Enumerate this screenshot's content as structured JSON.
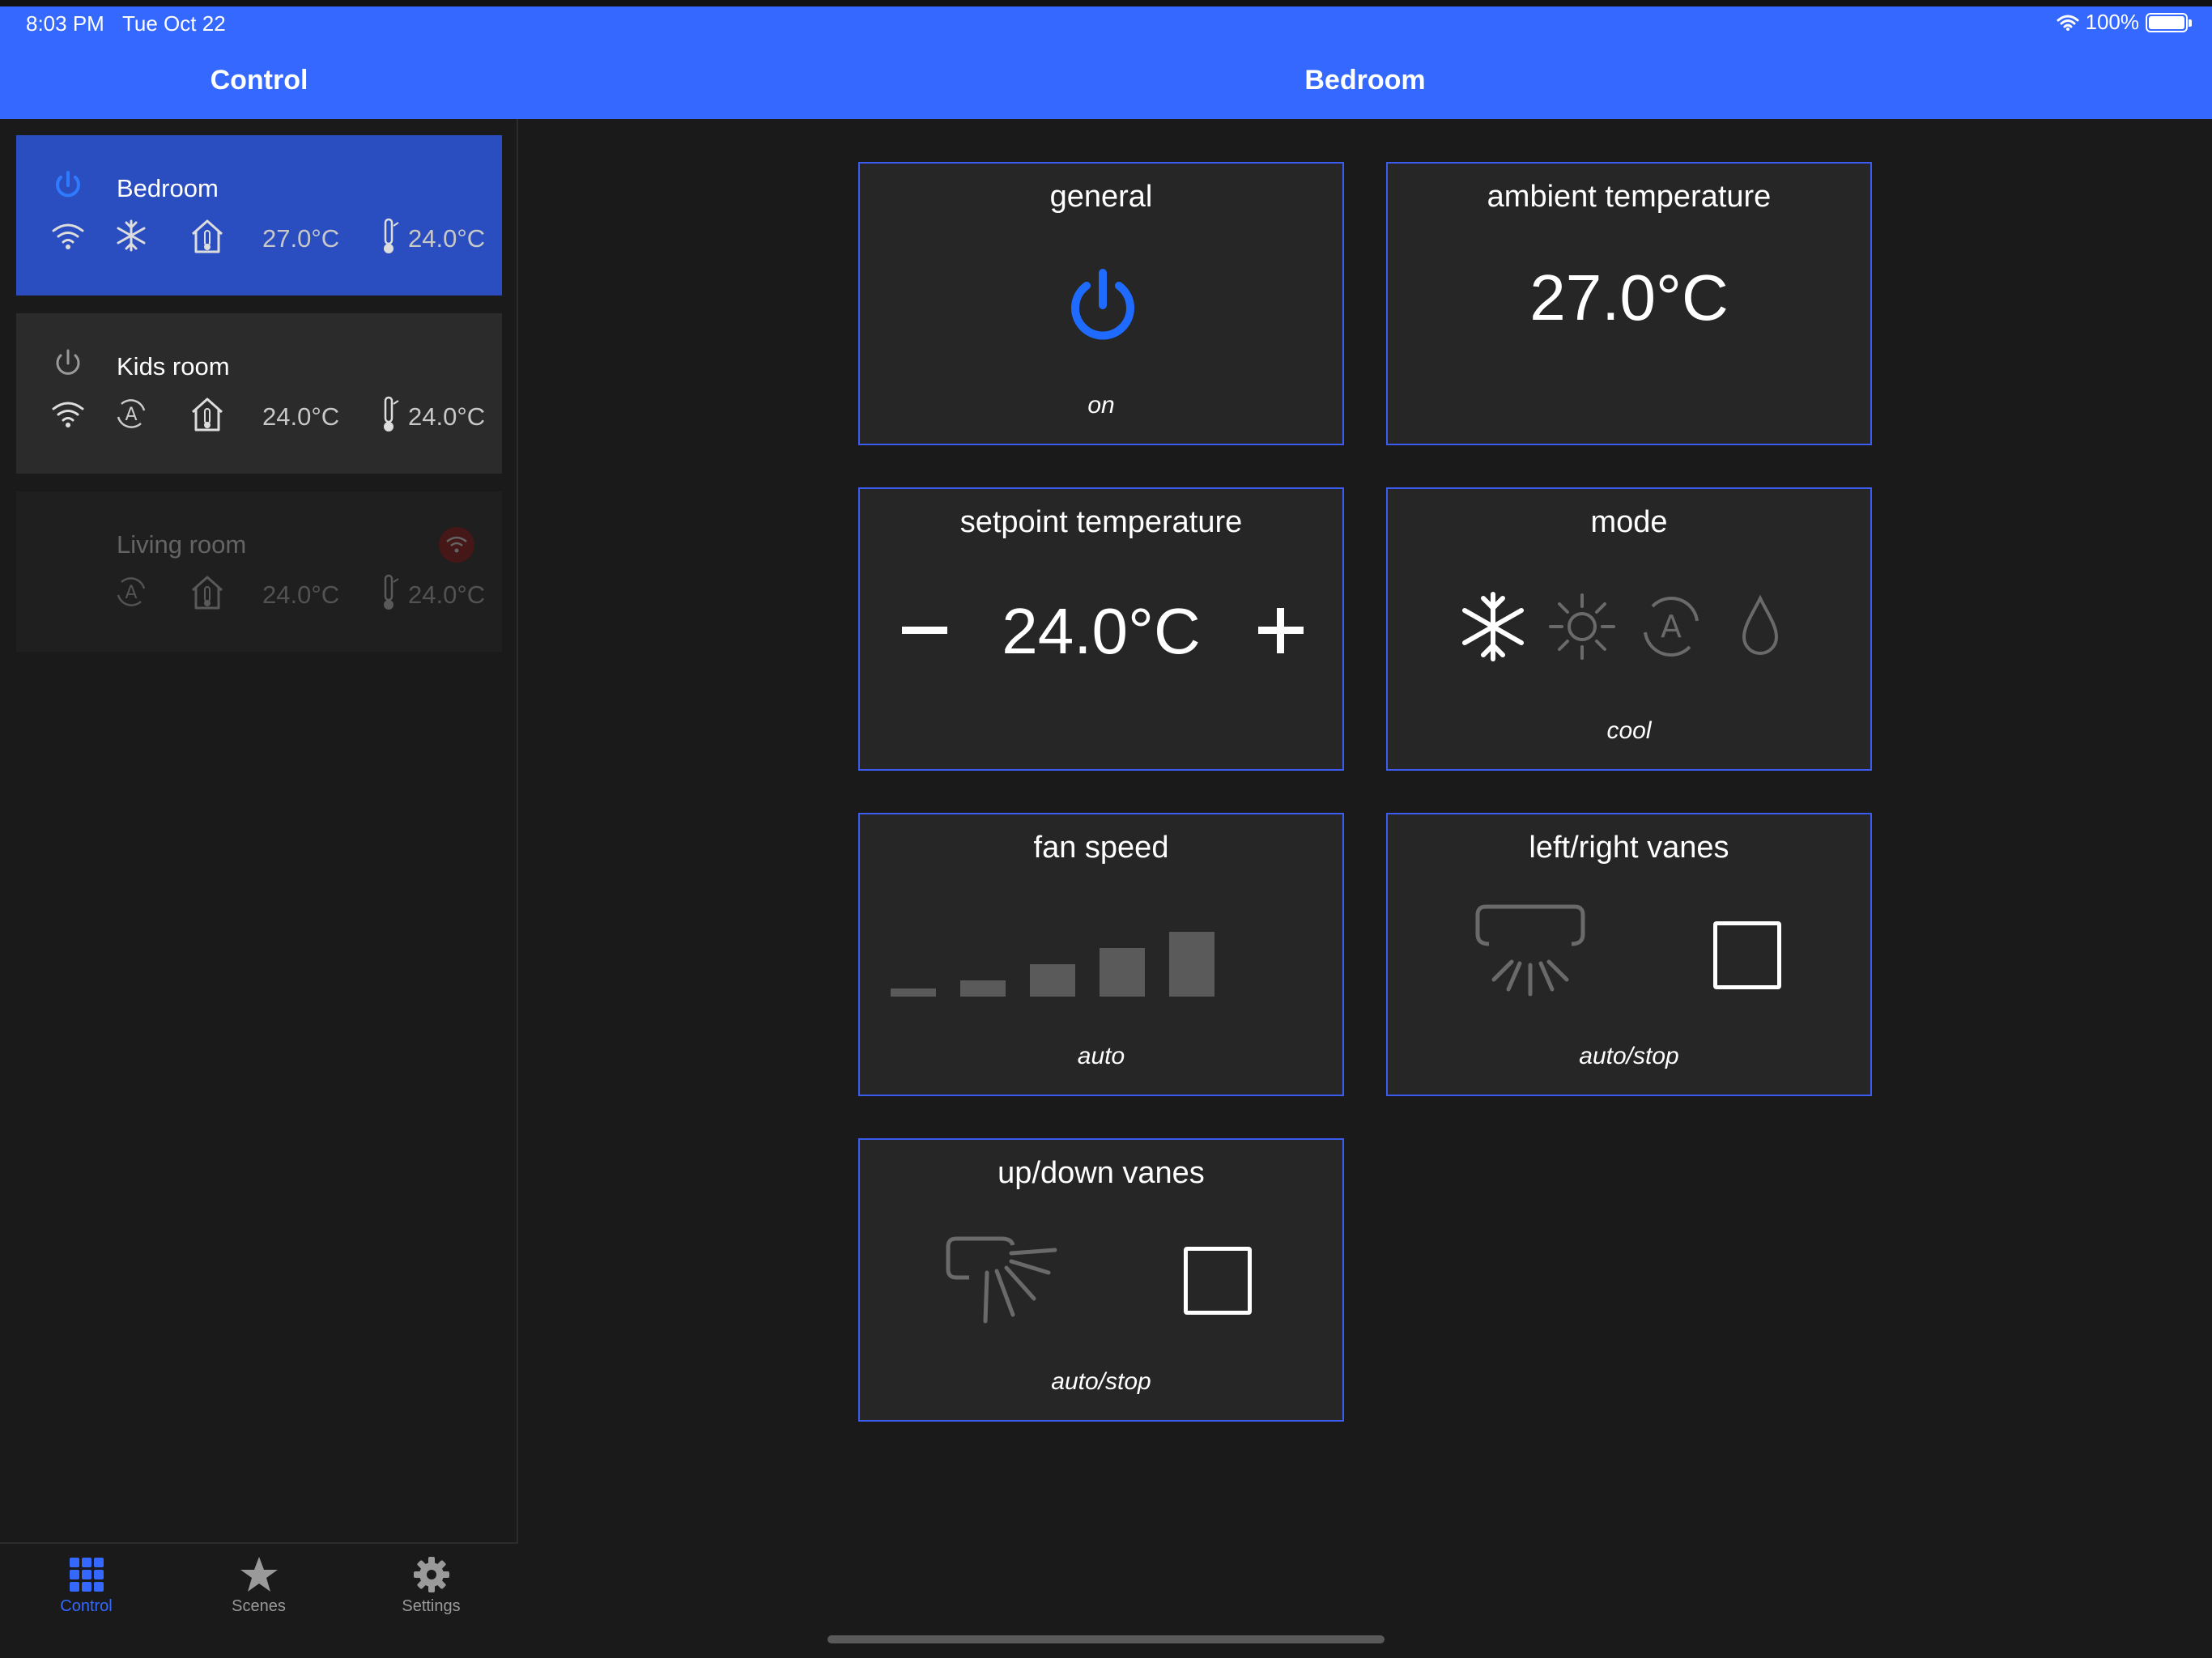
{
  "status": {
    "time": "8:03 PM",
    "date": "Tue Oct 22",
    "battery": "100%"
  },
  "header": {
    "left_title": "Control",
    "main_title": "Bedroom"
  },
  "colors": {
    "accent": "#3468fe",
    "tile_border": "#3a5cf0",
    "active_card": "#2a4ebf",
    "error": "#a01212"
  },
  "sidebar": {
    "rooms": [
      {
        "name": "Bedroom",
        "state": "on",
        "mode_icon": "snowflake-icon",
        "ambient": "27.0°C",
        "setpoint": "24.0°C",
        "connected": true
      },
      {
        "name": "Kids room",
        "state": "off",
        "mode_icon": "auto-mode-icon",
        "ambient": "24.0°C",
        "setpoint": "24.0°C",
        "connected": true
      },
      {
        "name": "Living room",
        "state": "offline",
        "mode_icon": "auto-mode-icon",
        "ambient": "24.0°C",
        "setpoint": "24.0°C",
        "connected": false
      }
    ]
  },
  "tabs": [
    {
      "label": "Control",
      "icon": "grid-icon",
      "active": true
    },
    {
      "label": "Scenes",
      "icon": "star-icon",
      "active": false
    },
    {
      "label": "Settings",
      "icon": "gear-icon",
      "active": false
    }
  ],
  "tiles": {
    "general": {
      "title": "general",
      "value": "on"
    },
    "ambient": {
      "title": "ambient temperature",
      "value": "27.0°C"
    },
    "setpoint": {
      "title": "setpoint temperature",
      "value": "24.0°C",
      "minus": "−",
      "plus": "+"
    },
    "mode": {
      "title": "mode",
      "value": "cool",
      "options": [
        "cool",
        "heat",
        "auto",
        "dry"
      ],
      "selected": "cool"
    },
    "fan": {
      "title": "fan speed",
      "value": "auto",
      "levels": 5,
      "selected_level": 0
    },
    "lr_vanes": {
      "title": "left/right vanes",
      "value": "auto/stop"
    },
    "ud_vanes": {
      "title": "up/down vanes",
      "value": "auto/stop"
    }
  }
}
